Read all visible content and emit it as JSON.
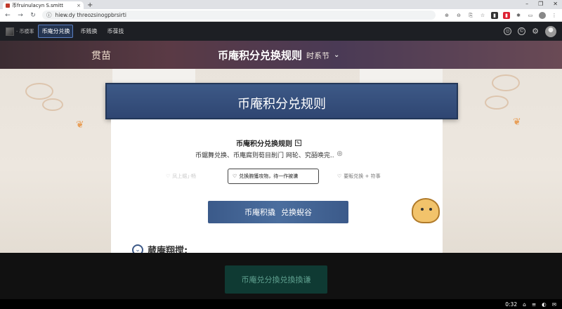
{
  "browser": {
    "tab_title": "币fruinulacyn S.smitt",
    "tab_close": "×",
    "new_tab": "+",
    "url": "hiew.dy threozsinogpbrsirti",
    "window_controls": [
      "–",
      "❐",
      "✕"
    ]
  },
  "site_nav": {
    "logo_text": "· 币模率",
    "items": [
      {
        "label": "币庵分兑换",
        "active": true
      },
      {
        "label": "币贱换",
        "active": false
      },
      {
        "label": "币葆技",
        "active": false
      }
    ]
  },
  "hero": {
    "left_label": "贯苗",
    "title": "币庵积分兑换规则",
    "subtitle": "时系节",
    "chevron": "⌄"
  },
  "banner": {
    "title": "币庵积分兑规则"
  },
  "card": {
    "title": "币庵积分兑换规则",
    "title_icon": "✎",
    "description": "币鋸舞兑换、币庵腐则荀目削门 网轮、究皕唤完.."
  },
  "options": [
    {
      "label": "凤上鋸」·畅",
      "icon": "heart-icon"
    },
    {
      "label": "兑换腕獲攻物，待一作被瀵",
      "icon": "heart-icon"
    },
    {
      "label": "要販兑换 + 符事",
      "icon": "heart-icon"
    }
  ],
  "cta": {
    "label_a": "币庵积撬",
    "label_b": "兑换蜺谷"
  },
  "section": {
    "title": "蒇庵翔搅:"
  },
  "floating_button": {
    "label": "币庵兑分換兑換換谦"
  },
  "taskbar": {
    "time": "0:32",
    "tray": [
      "⌂",
      "≡",
      "◐",
      "✉"
    ]
  },
  "colors": {
    "banner_blue": "#3d5987",
    "nav_bg": "#1d1f24",
    "accent_green": "#0f3a33"
  }
}
